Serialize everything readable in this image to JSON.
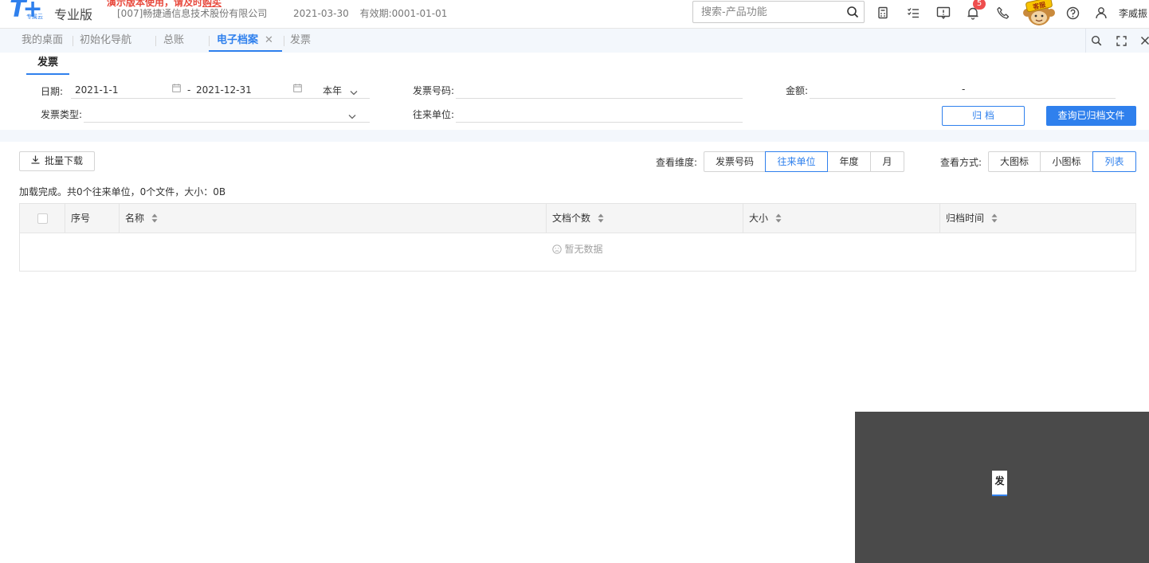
{
  "header": {
    "logo_text": "T+",
    "logo_sub": "专属云",
    "edition": "专业版",
    "trial_notice_prefix": "演示版本使用，请及时",
    "trial_notice_link": "购买",
    "company": "[007]畅捷通信息技术股份有限公司",
    "login_date": "2021-03-30",
    "validity": "有效期:0001-01-01",
    "search_placeholder": "搜索-产品功能",
    "notification_count": "5",
    "service_badge": "客服",
    "username": "李威振"
  },
  "tabs": [
    {
      "label": "我的桌面"
    },
    {
      "label": "初始化导航"
    },
    {
      "label": "总账"
    },
    {
      "label": "电子档案",
      "close": "✕"
    },
    {
      "label": "发票"
    }
  ],
  "filter": {
    "subtab": "发票",
    "date_label": "日期:",
    "date_from": "2021-1-1",
    "date_sep": "-",
    "date_to": "2021-12-31",
    "period": "本年",
    "invoice_no_label": "发票号码:",
    "amount_label": "金额:",
    "amount_sep": "-",
    "invoice_type_label": "发票类型:",
    "partner_label": "往来单位:",
    "archive_button": "归 档",
    "query_button": "查询已归档文件"
  },
  "toolbar": {
    "batch_download": "批量下载",
    "dimension_label": "查看维度:",
    "dimensions": [
      {
        "label": "发票号码",
        "selected": false
      },
      {
        "label": "往来单位",
        "selected": true
      },
      {
        "label": "年度",
        "selected": false
      },
      {
        "label": "月",
        "selected": false
      }
    ],
    "view_label": "查看方式:",
    "views": [
      {
        "label": "大图标",
        "selected": false
      },
      {
        "label": "小图标",
        "selected": false
      },
      {
        "label": "列表",
        "selected": true
      }
    ]
  },
  "status": "加载完成。共0个往来单位，0个文件，大小：0B",
  "table": {
    "columns": [
      "序号",
      "名称",
      "文档个数",
      "大小",
      "归档时间"
    ],
    "rows": [],
    "empty_text": "暂无数据"
  },
  "preview": {
    "chip_text": "发"
  },
  "colors": {
    "accent": "#2f80ed",
    "notice_red": "#e84a3e",
    "badge_red": "#ee4d4d"
  }
}
